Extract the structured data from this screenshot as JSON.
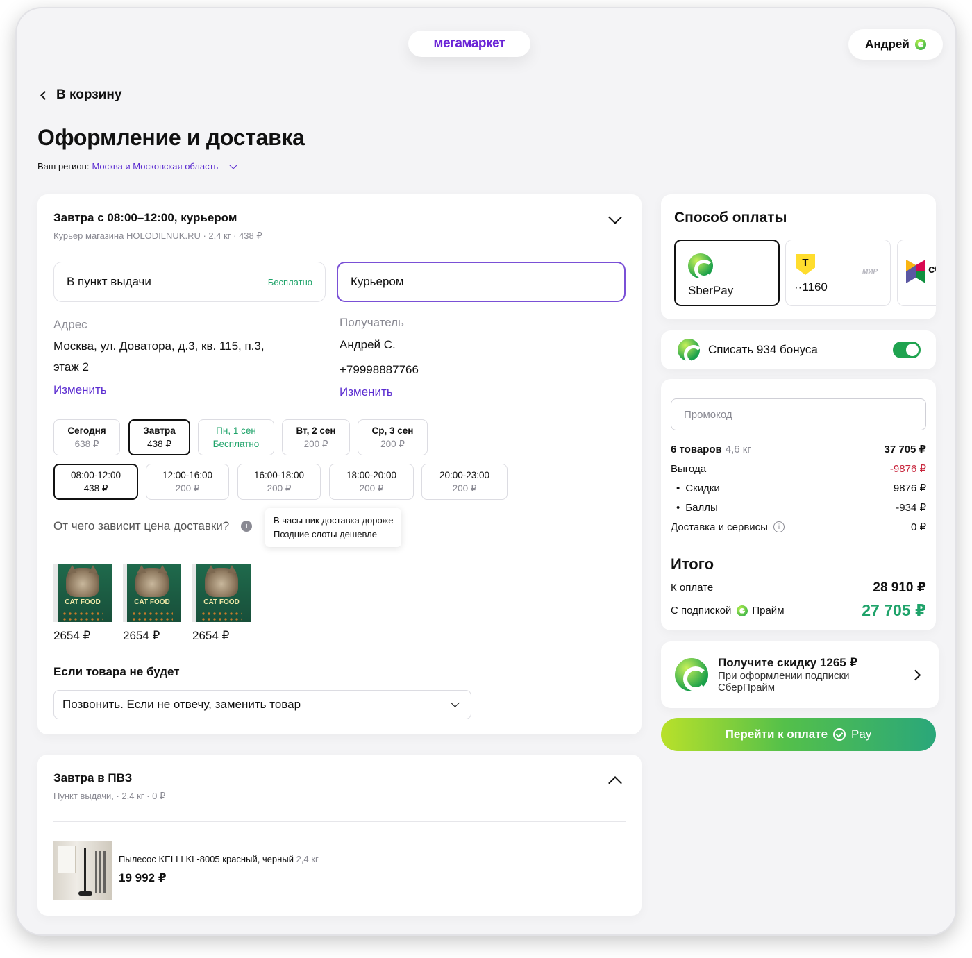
{
  "brand": {
    "logo": "мегамаркет",
    "accent": "#6a24d6",
    "green": "#1fa36a"
  },
  "user": {
    "name": "Андрей"
  },
  "nav": {
    "back_label": "В корзину"
  },
  "page": {
    "title": "Оформление и доставка",
    "region_label": "Ваш регион:",
    "region_value": "Москва и Московская область"
  },
  "delivery": {
    "title": "Завтра с 08:00–12:00, курьером",
    "subtitle": "Курьер магазина HOLODILNUK.RU · 2,4 кг · 438 ₽",
    "options": [
      {
        "label": "В пункт выдачи",
        "note": "Бесплатно",
        "selected": false
      },
      {
        "label": "Курьером",
        "note": "",
        "selected": true
      }
    ],
    "address": {
      "label": "Адрес",
      "line1": "Москва, ул. Доватора, д.3, кв. 115, п.3,",
      "line2": "этаж 2",
      "change": "Изменить"
    },
    "recipient": {
      "label": "Получатель",
      "name": "Андрей С.",
      "phone": "+79998887766",
      "change": "Изменить"
    },
    "days": [
      {
        "day": "Сегодня",
        "price": "638 ₽"
      },
      {
        "day": "Завтра",
        "price": "438 ₽"
      },
      {
        "day": "Пн, 1 сен",
        "price": "Бесплатно"
      },
      {
        "day": "Вт, 2 сен",
        "price": "200 ₽"
      },
      {
        "day": "Ср, 3 сен",
        "price": "200 ₽"
      }
    ],
    "slots": [
      {
        "time": "08:00-12:00",
        "price": "438 ₽"
      },
      {
        "time": "12:00-16:00",
        "price": "200 ₽"
      },
      {
        "time": "16:00-18:00",
        "price": "200 ₽"
      },
      {
        "time": "18:00-20:00",
        "price": "200 ₽"
      },
      {
        "time": "20:00-23:00",
        "price": "200 ₽"
      }
    ],
    "price_question": "От чего зависит цена доставки?",
    "tooltip": {
      "line1": "В часы пик доставка дороже",
      "line2": "Поздние слоты дешевле"
    },
    "products": [
      {
        "label": "CAT FOOD",
        "price": "2654 ₽"
      },
      {
        "label": "CAT FOOD",
        "price": "2654 ₽"
      },
      {
        "label": "CAT FOOD",
        "price": "2654 ₽"
      }
    ],
    "missing_title": "Если товара не будет",
    "missing_value": "Позвонить. Если не отвечу, заменить товар"
  },
  "pvz": {
    "title": "Завтра в ПВЗ",
    "subtitle": "Пункт выдачи, · 2,4 кг · 0 ₽",
    "item_name": "Пылесос KELLI KL-8005 красный, черный",
    "item_weight": "2,4 кг",
    "item_price": "19 992 ₽"
  },
  "payment": {
    "title": "Способ оплаты",
    "methods": [
      {
        "label": "SberPay",
        "icon": "sber-icon",
        "selected": true
      },
      {
        "label": "··1160",
        "icon": "tbank-icon",
        "badge": "МИР",
        "selected": false
      },
      {
        "label": "сб",
        "icon": "sbp-icon",
        "selected": false
      }
    ]
  },
  "bonus": {
    "label": "Списать 934 бонуса",
    "enabled": true
  },
  "summary": {
    "promo_placeholder": "Промокод",
    "items_label": "6 товаров",
    "items_weight": "4,6 кг",
    "items_total": "37 705 ₽",
    "benefit_label": "Выгода",
    "benefit_value": "-9876 ₽",
    "discounts_label": "Скидки",
    "discounts_value": "9876 ₽",
    "points_label": "Баллы",
    "points_value": "-934 ₽",
    "delivery_label": "Доставка и сервисы",
    "delivery_value": "0 ₽",
    "total_title": "Итого",
    "to_pay_label": "К оплате",
    "to_pay_value": "28 910 ₽",
    "subscription_label": "С подпиской",
    "subscription_brand": "Прайм",
    "subscription_value": "27 705 ₽"
  },
  "promo_card": {
    "title": "Получите скидку 1265 ₽",
    "text1": "При оформлении подписки",
    "text2": "СберПрайм"
  },
  "pay_button": {
    "label": "Перейти к оплате",
    "suffix": "Pay"
  }
}
